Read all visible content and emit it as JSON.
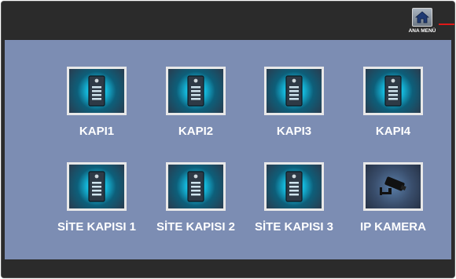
{
  "header": {
    "home_label": "ANA MENÜ",
    "home_icon": "home-icon",
    "accent_color": "#e01818"
  },
  "tiles": [
    {
      "label": "KAPI1",
      "icon": "door-intercom-icon"
    },
    {
      "label": "KAPI2",
      "icon": "door-intercom-icon"
    },
    {
      "label": "KAPI3",
      "icon": "door-intercom-icon"
    },
    {
      "label": "KAPI4",
      "icon": "door-intercom-icon"
    },
    {
      "label": "SİTE KAPISI 1",
      "icon": "door-intercom-icon"
    },
    {
      "label": "SİTE KAPISI 2",
      "icon": "door-intercom-icon"
    },
    {
      "label": "SİTE KAPISI 3",
      "icon": "door-intercom-icon"
    },
    {
      "label": "IP KAMERA",
      "icon": "camera-icon"
    }
  ],
  "colors": {
    "panel": "#7c8db3",
    "bar": "#2b2b2b",
    "tile_glow": "#17c8ec"
  }
}
